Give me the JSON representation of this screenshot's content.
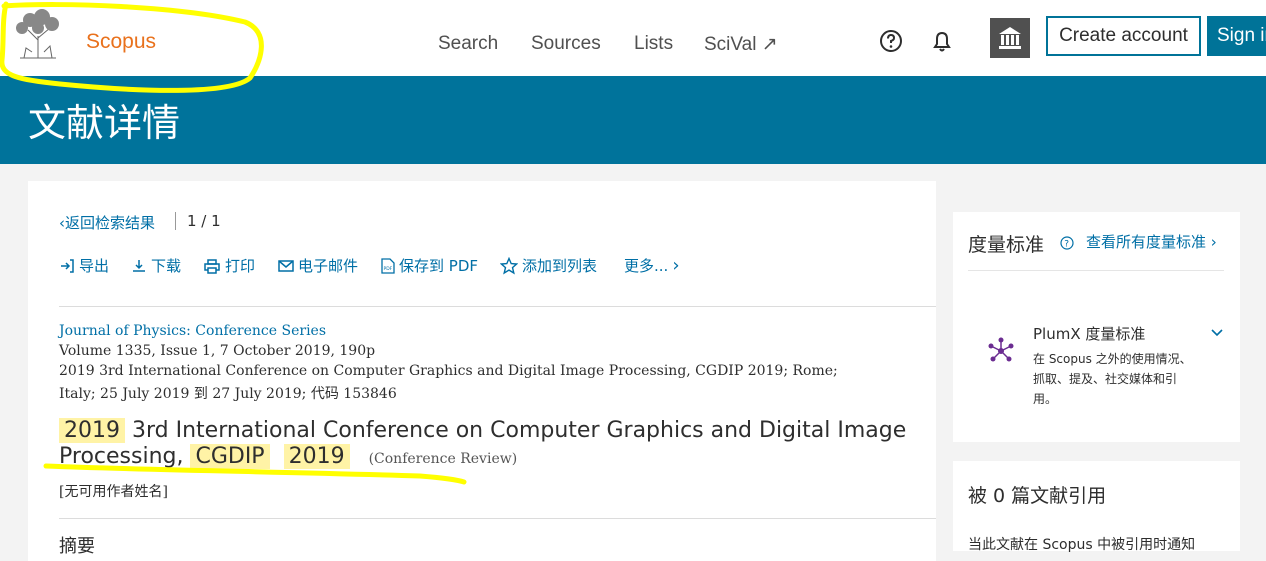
{
  "header": {
    "brand": "Scopus",
    "nav": [
      "Search",
      "Sources",
      "Lists",
      "SciVal ↗"
    ],
    "create_account": "Create account",
    "sign_in": "Sign in"
  },
  "banner": {
    "title": "文献详情"
  },
  "main": {
    "back_link": "返回检索结果",
    "pager": "1 / 1",
    "toolbar": [
      "导出",
      "下载",
      "打印",
      "电子邮件",
      "保存到 PDF",
      "添加到列表",
      "更多..."
    ],
    "source_title": "Journal of Physics: Conference Series",
    "meta_line1": "Volume 1335, Issue 1, 7 October 2019, 190p",
    "meta_line2": "2019 3rd International Conference on Computer Graphics and Digital Image Processing, CGDIP 2019; Rome;",
    "meta_line3": "Italy; 25 July 2019 到 27 July 2019; 代码 153846",
    "title_hl1": "2019",
    "title_part1": " 3rd International Conference on Computer Graphics and Digital Image",
    "title_part2": "Processing, ",
    "title_hl2": "CGDIP",
    "title_hl3": "2019",
    "doc_type": "(Conference Review)",
    "authors": "[无可用作者姓名]",
    "abstract_heading": "摘要"
  },
  "sidebar": {
    "metrics_title": "度量标准",
    "metrics_link": "查看所有度量标准",
    "plumx_title": "PlumX 度量标准",
    "plumx_desc": "在 Scopus 之外的使用情况、抓取、提及、社交媒体和引用。",
    "cited_title": "被 0 篇文献引用",
    "cited_desc": "当此文献在 Scopus 中被引用时通知"
  },
  "colors": {
    "accent": "#007398",
    "brand": "#e9711c",
    "highlight": "#fff3a6",
    "annotation": "#ffff00"
  }
}
